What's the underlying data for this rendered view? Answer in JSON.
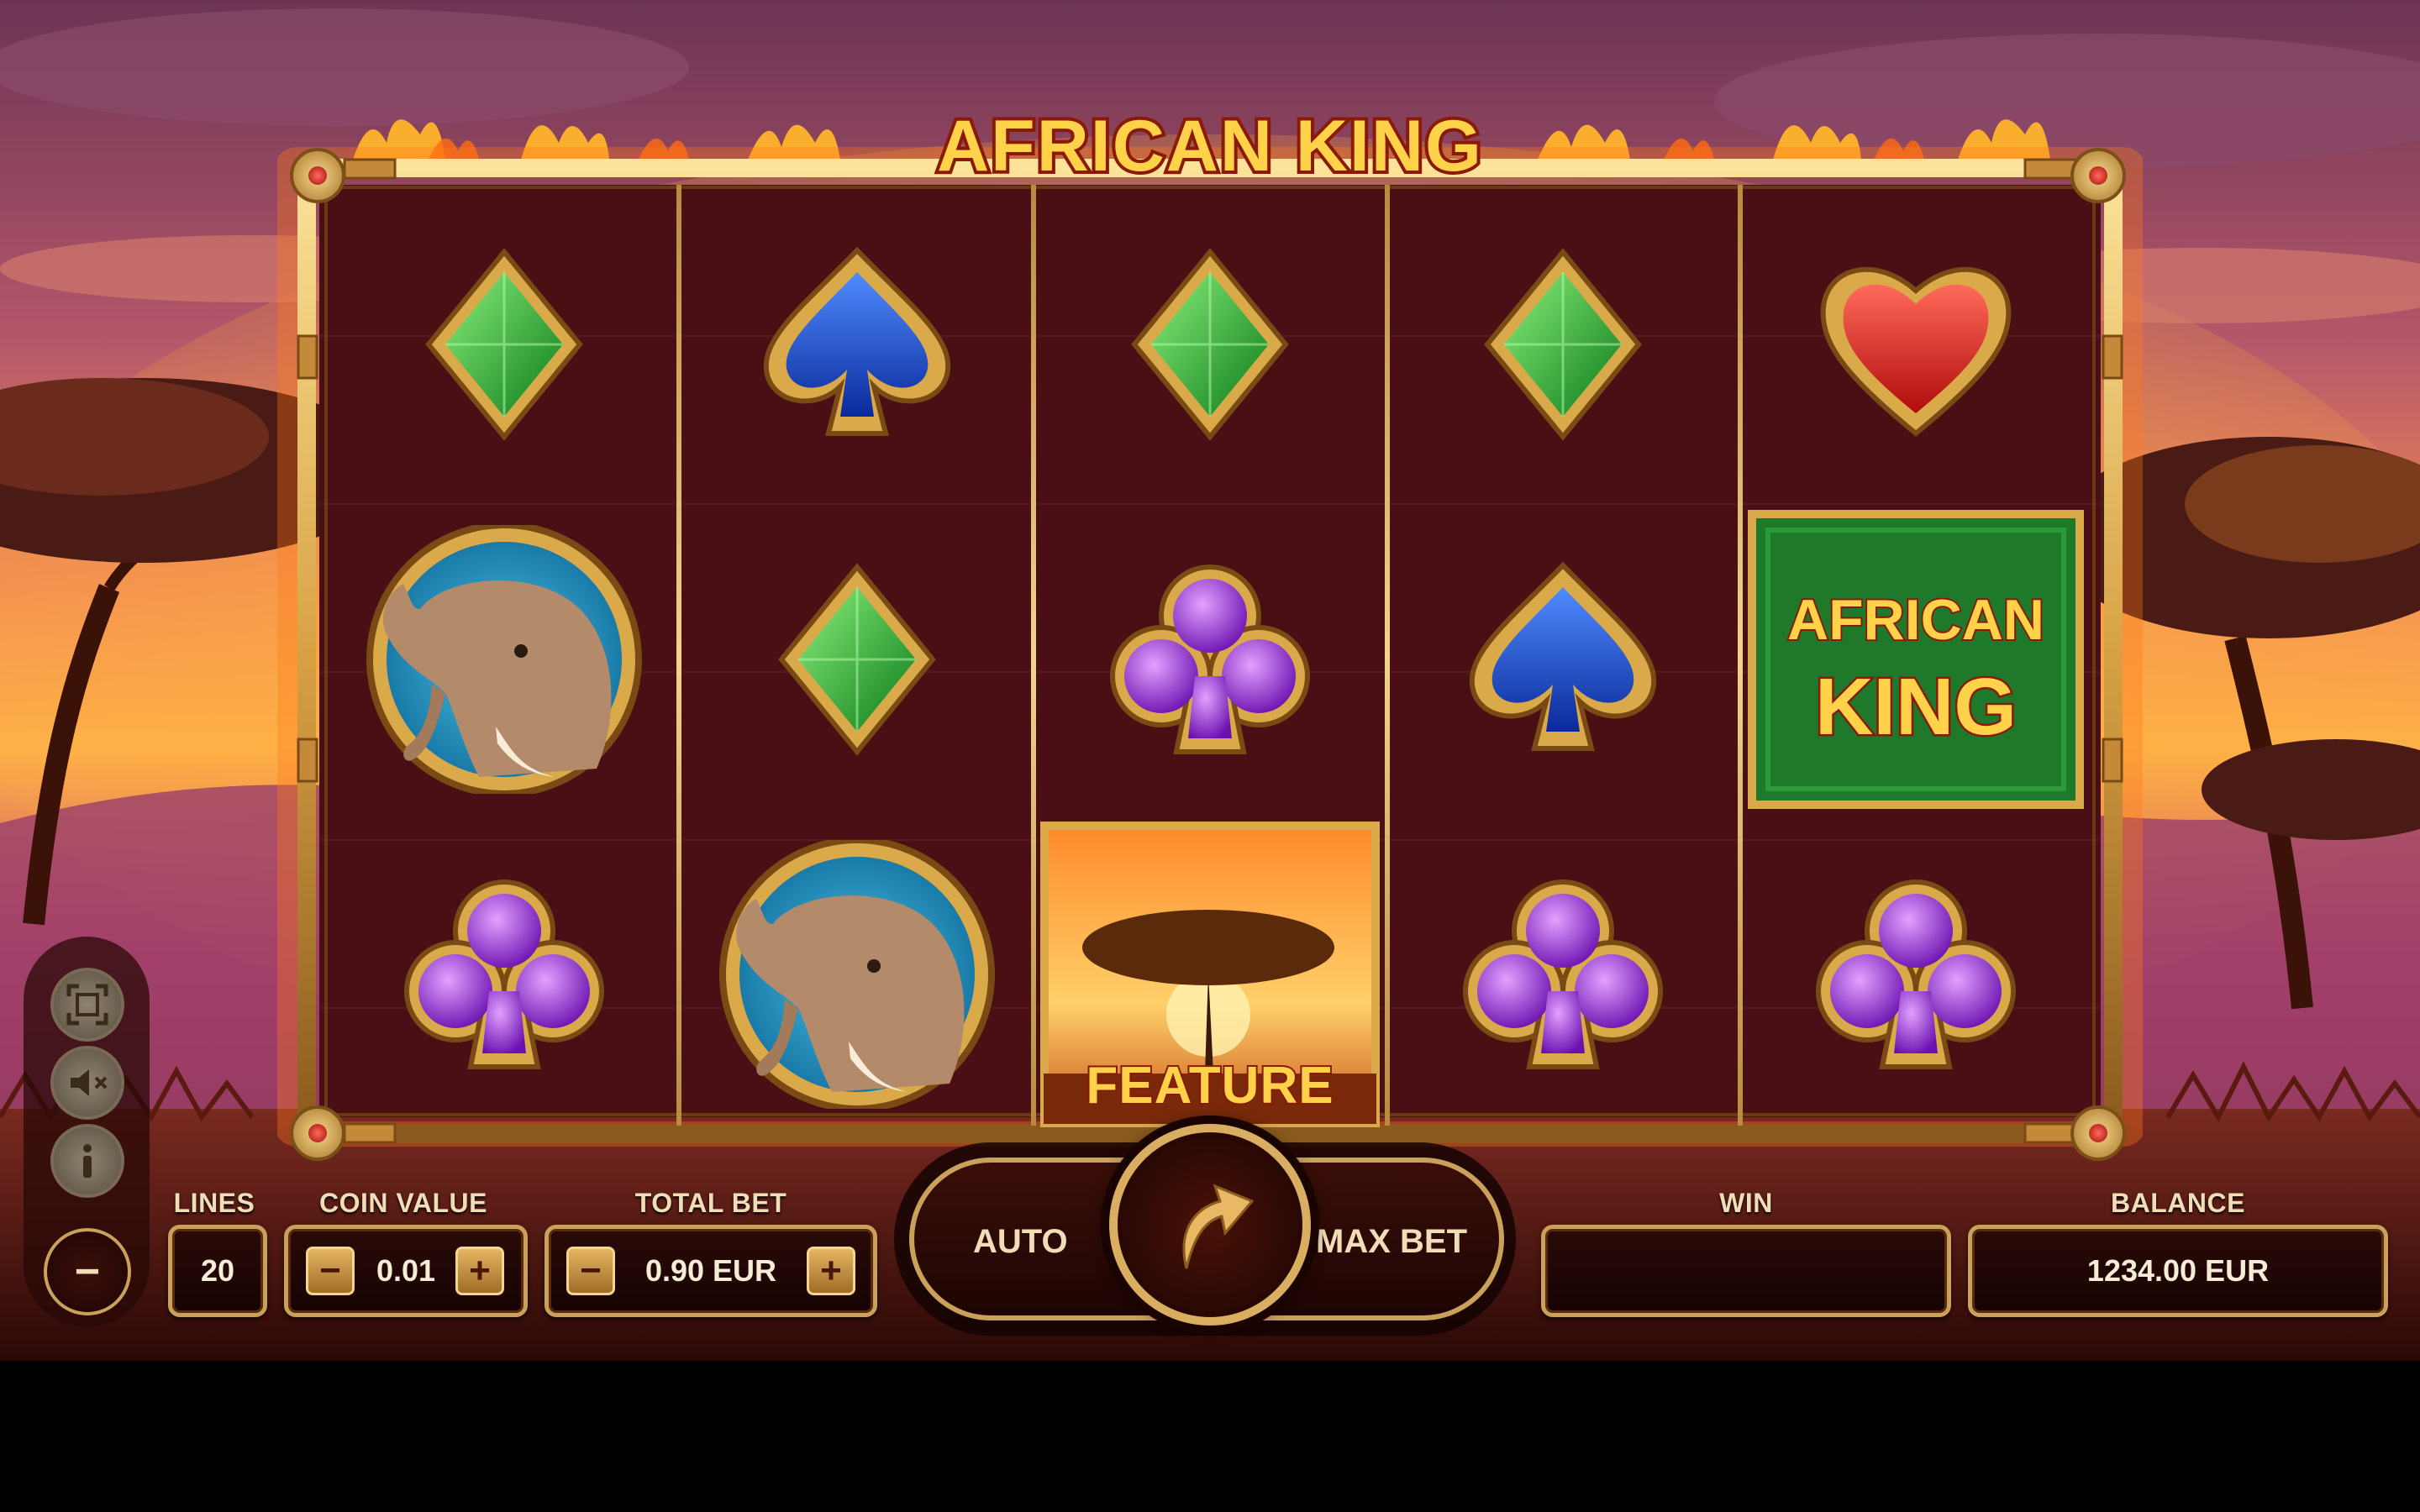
{
  "game": {
    "title": "AFRICAN KING",
    "logo_symbol_line1": "AFRICAN",
    "logo_symbol_line2": "KING",
    "feature_label": "FEATURE"
  },
  "reels": [
    [
      "green-diamond",
      "elephant",
      "purple-club"
    ],
    [
      "blue-spade",
      "green-diamond",
      "elephant"
    ],
    [
      "green-diamond",
      "purple-club",
      "feature-tree"
    ],
    [
      "green-diamond",
      "blue-spade",
      "purple-club"
    ],
    [
      "red-heart",
      "african-king-logo",
      "purple-club"
    ]
  ],
  "controls": {
    "lines_label": "LINES",
    "lines_value": "20",
    "coin_value_label": "COIN VALUE",
    "coin_value": "0.01",
    "total_bet_label": "TOTAL BET",
    "total_bet_value": "0.90 EUR",
    "auto_label": "AUTO",
    "max_bet_label": "MAX BET",
    "win_label": "WIN",
    "win_value": "",
    "balance_label": "BALANCE",
    "balance_value": "1234.00 EUR",
    "minus": "−",
    "plus": "+"
  },
  "side_buttons": [
    "fullscreen-icon",
    "mute-icon",
    "info-icon",
    "minimize-icon"
  ],
  "colors": {
    "frame_gold": "#e2b45a",
    "reel_bg": "#4a0f14",
    "sky_top": "#7a3e5c",
    "horizon": "#ff9a2e",
    "title_fill": "#ffd24a",
    "title_stroke": "#8a1a06"
  }
}
